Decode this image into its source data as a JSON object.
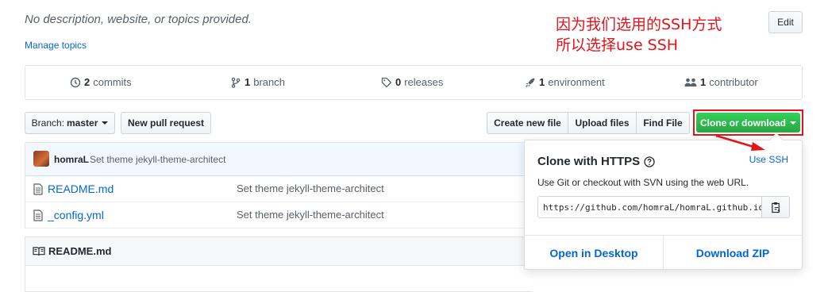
{
  "repo": {
    "description": "No description, website, or topics provided.",
    "manage_topics": "Manage topics",
    "edit_label": "Edit"
  },
  "annotation": {
    "text": "因为我们选用的SSH方式\n所以选择use SSH",
    "color": "#e3141b"
  },
  "numbers_summary": {
    "commits": {
      "count": "2",
      "label": "commits",
      "icon": "history-icon"
    },
    "branches": {
      "count": "1",
      "label": "branch",
      "icon": "git-branch-icon"
    },
    "releases": {
      "count": "0",
      "label": "releases",
      "icon": "tag-icon"
    },
    "environments": {
      "count": "1",
      "label": "environment",
      "icon": "rocket-icon"
    },
    "contributors": {
      "count": "1",
      "label": "contributor",
      "icon": "organization-icon"
    }
  },
  "toolbar": {
    "branch_prefix": "Branch:",
    "branch_name": "master",
    "new_pull_request": "New pull request",
    "create_new_file": "Create new file",
    "upload_files": "Upload files",
    "find_file": "Find File",
    "clone_or_download": "Clone or download"
  },
  "latest_commit": {
    "author": "homraL",
    "message": "Set theme jekyll-theme-architect"
  },
  "files": [
    {
      "name": "README.md",
      "message": "Set theme jekyll-theme-architect"
    },
    {
      "name": "_config.yml",
      "message": "Set theme jekyll-theme-architect"
    }
  ],
  "readme": {
    "title": "README.md"
  },
  "clone_popover": {
    "title": "Clone with HTTPS",
    "use_ssh": "Use SSH",
    "description": "Use Git or checkout with SVN using the web URL.",
    "url": "https://github.com/homraL/homraL.github.io.git",
    "open_in_desktop": "Open in Desktop",
    "download_zip": "Download ZIP"
  },
  "colors": {
    "link": "#0366d6",
    "clone_green": "#28a745",
    "highlight_red": "#e3141b"
  }
}
